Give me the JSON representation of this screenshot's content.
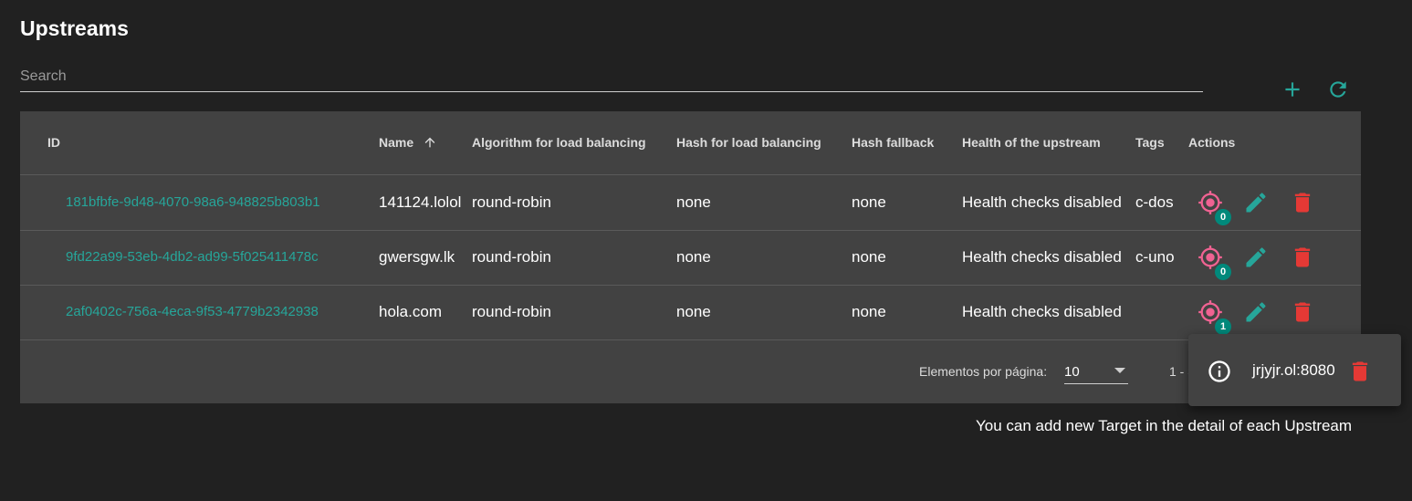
{
  "page": {
    "title": "Upstreams"
  },
  "search": {
    "placeholder": "Search",
    "value": ""
  },
  "toolbar": {
    "add_icon": "plus-icon",
    "refresh_icon": "refresh-icon"
  },
  "colors": {
    "accent": "#26a69a",
    "delete": "#e53935",
    "target": "#f06292",
    "badge": "#00897b",
    "background": "#212121",
    "card": "#424242"
  },
  "table": {
    "headers": {
      "id": "ID",
      "name": "Name",
      "algorithm": "Algorithm for load balancing",
      "hash": "Hash for load balancing",
      "hash_fallback": "Hash fallback",
      "health": "Health of the upstream",
      "tags": "Tags",
      "actions": "Actions"
    },
    "sort": {
      "column": "name",
      "direction": "ascending"
    },
    "rows": [
      {
        "id": "181bfbfe-9d48-4070-98a6-948825b803b1",
        "name": "141124.lolol",
        "algorithm": "round-robin",
        "hash": "none",
        "hash_fallback": "none",
        "health": "Health checks disabled",
        "tags": "c-dos",
        "targets": "0"
      },
      {
        "id": "9fd22a99-53eb-4db2-ad99-5f025411478c",
        "name": "gwersgw.lk",
        "algorithm": "round-robin",
        "hash": "none",
        "hash_fallback": "none",
        "health": "Health checks disabled",
        "tags": "c-uno",
        "targets": "0"
      },
      {
        "id": "2af0402c-756a-4eca-9f53-4779b2342938",
        "name": "hola.com",
        "algorithm": "round-robin",
        "hash": "none",
        "hash_fallback": "none",
        "health": "Health checks disabled",
        "tags": "",
        "targets": "1"
      }
    ]
  },
  "paginator": {
    "label": "Elementos por página:",
    "page_size": "10",
    "range": "1 - 3"
  },
  "popover": {
    "target": "jrjyjr.ol:8080"
  },
  "hint": "You can add new Target in the detail of each Upstream"
}
